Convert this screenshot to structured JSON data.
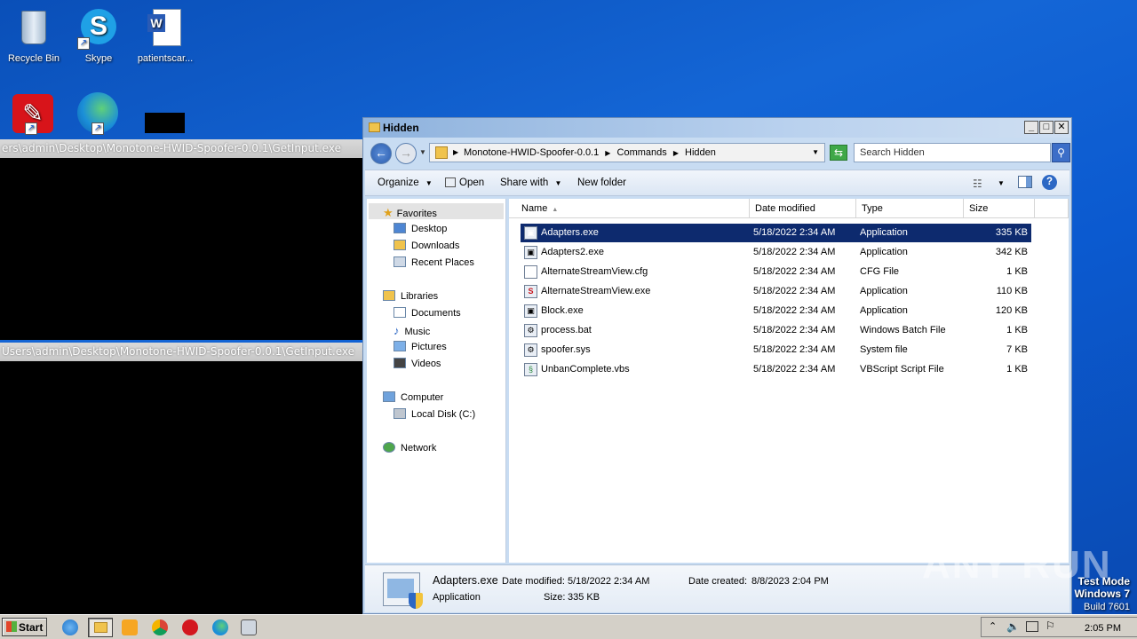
{
  "desktop": {
    "icons": [
      {
        "label": "Recycle Bin"
      },
      {
        "label": "Skype"
      },
      {
        "label": "patientscar..."
      }
    ]
  },
  "consoles": [
    {
      "title": "ers\\admin\\Desktop\\Monotone-HWID-Spoofer-0.0.1\\GetInput.exe"
    },
    {
      "title": "Users\\admin\\Desktop\\Monotone-HWID-Spoofer-0.0.1\\GetInput.exe"
    }
  ],
  "window": {
    "title": "Hidden",
    "breadcrumb": [
      "Monotone-HWID-Spoofer-0.0.1",
      "Commands",
      "Hidden"
    ],
    "search_placeholder": "Search Hidden",
    "toolbar": {
      "organize": "Organize",
      "open": "Open",
      "share_with": "Share with",
      "new_folder": "New folder"
    },
    "nav": {
      "favorites": "Favorites",
      "desktop": "Desktop",
      "downloads": "Downloads",
      "recent_places": "Recent Places",
      "libraries": "Libraries",
      "documents": "Documents",
      "music": "Music",
      "pictures": "Pictures",
      "videos": "Videos",
      "computer": "Computer",
      "local_disk": "Local Disk (C:)",
      "network": "Network"
    },
    "columns": {
      "name": "Name",
      "date": "Date modified",
      "type": "Type",
      "size": "Size"
    },
    "files": [
      {
        "name": "Adapters.exe",
        "date": "5/18/2022 2:34 AM",
        "type": "Application",
        "size": "335 KB"
      },
      {
        "name": "Adapters2.exe",
        "date": "5/18/2022 2:34 AM",
        "type": "Application",
        "size": "342 KB"
      },
      {
        "name": "AlternateStreamView.cfg",
        "date": "5/18/2022 2:34 AM",
        "type": "CFG File",
        "size": "1 KB"
      },
      {
        "name": "AlternateStreamView.exe",
        "date": "5/18/2022 2:34 AM",
        "type": "Application",
        "size": "110 KB"
      },
      {
        "name": "Block.exe",
        "date": "5/18/2022 2:34 AM",
        "type": "Application",
        "size": "120 KB"
      },
      {
        "name": "process.bat",
        "date": "5/18/2022 2:34 AM",
        "type": "Windows Batch File",
        "size": "1 KB"
      },
      {
        "name": "spoofer.sys",
        "date": "5/18/2022 2:34 AM",
        "type": "System file",
        "size": "7 KB"
      },
      {
        "name": "UnbanComplete.vbs",
        "date": "5/18/2022 2:34 AM",
        "type": "VBScript Script File",
        "size": "1 KB"
      }
    ],
    "details": {
      "name": "Adapters.exe",
      "modified_label": "Date modified:",
      "modified_value": "5/18/2022 2:34 AM",
      "created_label": "Date created:",
      "created_value": "8/8/2023 2:04 PM",
      "type": "Application",
      "size_label": "Size:",
      "size_value": "335 KB"
    }
  },
  "taskbar": {
    "start": "Start",
    "clock": "2:05 PM"
  },
  "watermark": {
    "line1": "Test Mode",
    "line2": "Windows 7",
    "line3": "Build 7601",
    "brand": "ANY RUN"
  }
}
